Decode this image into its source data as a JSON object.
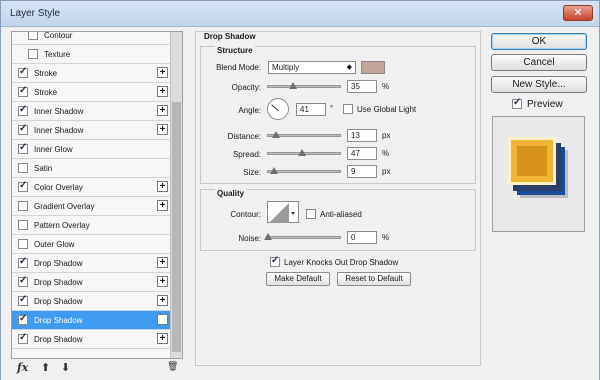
{
  "window": {
    "title": "Layer Style",
    "close": "✕"
  },
  "styles_list": {
    "items": [
      {
        "label": "Contour",
        "checked": false,
        "indent": true,
        "plus": false
      },
      {
        "label": "Texture",
        "checked": false,
        "indent": true,
        "plus": false
      },
      {
        "label": "Stroke",
        "checked": true,
        "plus": true
      },
      {
        "label": "Stroke",
        "checked": true,
        "plus": true
      },
      {
        "label": "Inner Shadow",
        "checked": true,
        "plus": true
      },
      {
        "label": "Inner Shadow",
        "checked": true,
        "plus": true
      },
      {
        "label": "Inner Glow",
        "checked": true,
        "plus": false
      },
      {
        "label": "Satin",
        "checked": false,
        "plus": false
      },
      {
        "label": "Color Overlay",
        "checked": true,
        "plus": true
      },
      {
        "label": "Gradient Overlay",
        "checked": false,
        "plus": true
      },
      {
        "label": "Pattern Overlay",
        "checked": false,
        "plus": false
      },
      {
        "label": "Outer Glow",
        "checked": false,
        "plus": false
      },
      {
        "label": "Drop Shadow",
        "checked": true,
        "plus": true
      },
      {
        "label": "Drop Shadow",
        "checked": true,
        "plus": true
      },
      {
        "label": "Drop Shadow",
        "checked": true,
        "plus": true
      },
      {
        "label": "Drop Shadow",
        "checked": true,
        "plus": true,
        "selected": true
      },
      {
        "label": "Drop Shadow",
        "checked": true,
        "plus": true
      }
    ],
    "toolbar": {
      "fx": "fx",
      "up": "⬆",
      "down": "⬇",
      "trash": "🗑"
    }
  },
  "drop_shadow": {
    "title": "Drop Shadow",
    "structure": {
      "title": "Structure",
      "blend_mode_label": "Blend Mode:",
      "blend_mode_value": "Multiply",
      "shadow_color": "#c3a79b",
      "opacity_label": "Opacity:",
      "opacity_value": "35",
      "opacity_unit": "%",
      "opacity_fraction": 0.35,
      "angle_label": "Angle:",
      "angle_value": "41",
      "angle_unit": "°",
      "use_global_light_label": "Use Global Light",
      "use_global_light": false,
      "distance_label": "Distance:",
      "distance_value": "13",
      "distance_unit": "px",
      "spread_label": "Spread:",
      "spread_value": "47",
      "spread_unit": "%",
      "spread_fraction": 0.47,
      "size_label": "Size:",
      "size_value": "9",
      "size_unit": "px"
    },
    "quality": {
      "title": "Quality",
      "contour_label": "Contour:",
      "anti_aliased_label": "Anti-aliased",
      "anti_aliased": false,
      "noise_label": "Noise:",
      "noise_value": "0",
      "noise_unit": "%"
    },
    "knocks_out_label": "Layer Knocks Out Drop Shadow",
    "knocks_out": true,
    "make_default_label": "Make Default",
    "reset_default_label": "Reset to Default"
  },
  "buttons": {
    "ok": "OK",
    "cancel": "Cancel",
    "new_style": "New Style...",
    "preview_label": "Preview",
    "preview_checked": true
  }
}
